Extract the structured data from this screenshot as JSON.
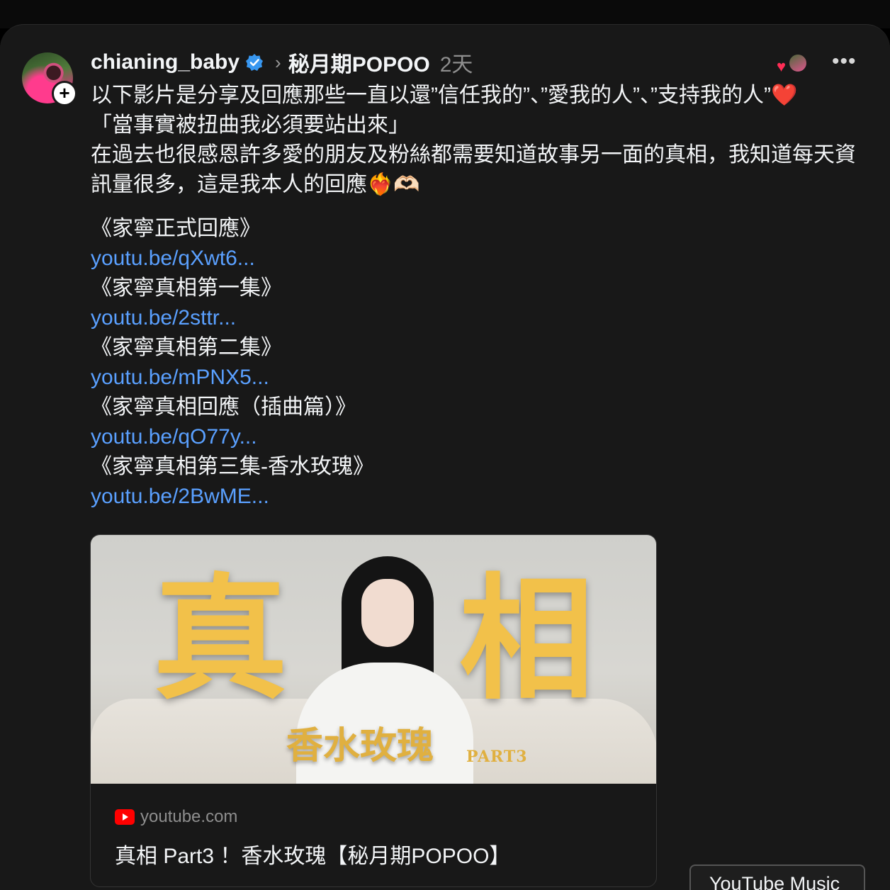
{
  "post": {
    "username": "chianing_baby",
    "community": "秘月期POPOO",
    "time": "2天",
    "text_lines": [
      "以下影片是分享及回應那些一直以還”信任我的”、”愛我的人”、”支持我的人”❤️",
      "「當事實被扭曲我必須要站出來」",
      "在過去也很感恩許多愛的朋友及粉絲都需要知道故事另一面的真相，我知道每天資訊量很多，這是我本人的回應❤️‍🔥🫶🏻"
    ],
    "links": [
      {
        "title": "《家寧正式回應》",
        "url": "youtu.be/qXwt6..."
      },
      {
        "title": "《家寧真相第一集》",
        "url": "youtu.be/2sttr..."
      },
      {
        "title": "《家寧真相第二集》",
        "url": "youtu.be/mPNX5..."
      },
      {
        "title": "《家寧真相回應（插曲篇）》",
        "url": "youtu.be/qO77y..."
      },
      {
        "title": "《家寧真相第三集-香水玫瑰》",
        "url": "youtu.be/2BwME..."
      }
    ]
  },
  "card": {
    "thumb_char_left": "真",
    "thumb_char_right": "相",
    "thumb_subtitle": "香水玫瑰",
    "thumb_part": "PART3",
    "domain": "youtube.com",
    "title": "真相 Part3 ！香水玫瑰【秘月期POPOO】"
  },
  "footer": {
    "yt_music_label": "YouTube Music"
  },
  "colors": {
    "background": "#181818",
    "link": "#5aa0ff",
    "verified": "#3897f0",
    "thumb_gold": "#f2c14a"
  },
  "icons": [
    "avatar-plus-icon",
    "verified-badge-icon",
    "chevron-right-icon",
    "heart-icon",
    "more-icon",
    "youtube-icon"
  ]
}
